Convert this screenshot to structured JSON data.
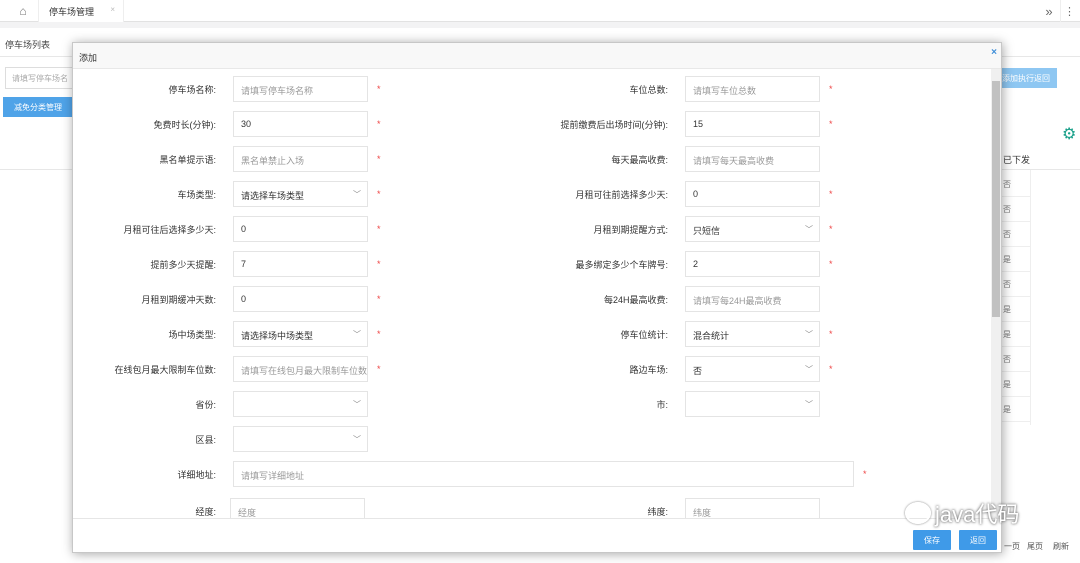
{
  "topbar": {
    "home_icon": "home-icon",
    "tab_label": "停车场管理",
    "tab_close": "×",
    "more_icon": "»"
  },
  "background": {
    "title": "停车场列表",
    "search_placeholder": "请填写停车场名",
    "blue_button": "减免分类管理",
    "right_button": "添加执行返回",
    "column_header": "已下发",
    "cells": [
      "否",
      "否",
      "否",
      "是",
      "否",
      "是",
      "是",
      "否",
      "是",
      "是"
    ],
    "pager": {
      "last": "尾页",
      "refresh": "刷新",
      "prev": "一页"
    }
  },
  "modal": {
    "title": "添加",
    "close": "×",
    "save_label": "保存",
    "back_label": "返回",
    "fields": {
      "parking_name": {
        "label": "停车场名称:",
        "placeholder": "请填写停车场名称"
      },
      "total_spaces": {
        "label": "车位总数:",
        "placeholder": "请填写车位总数"
      },
      "free_minutes": {
        "label": "免费时长(分钟):",
        "value": "30"
      },
      "exit_after_pay": {
        "label": "提前缴费后出场时间(分钟):",
        "value": "15"
      },
      "blacklist_tip": {
        "label": "黑名单提示语:",
        "value": "黑名单禁止入场"
      },
      "daily_max_fee": {
        "label": "每天最高收费:",
        "placeholder": "请填写每天最高收费"
      },
      "lot_type": {
        "label": "车场类型:",
        "value": "请选择车场类型"
      },
      "monthly_before_days": {
        "label": "月租可往前选择多少天:",
        "value": "0"
      },
      "monthly_after_days": {
        "label": "月租可往后选择多少天:",
        "value": "0"
      },
      "expire_reminder": {
        "label": "月租到期提醒方式:",
        "value": "只短信"
      },
      "remind_days": {
        "label": "提前多少天提醒:",
        "value": "7"
      },
      "max_plates": {
        "label": "最多绑定多少个车牌号:",
        "value": "2"
      },
      "grace_days": {
        "label": "月租到期缓冲天数:",
        "value": "0"
      },
      "max_24h_fee": {
        "label": "每24H最高收费:",
        "placeholder": "请填写每24H最高收费"
      },
      "inner_lot_type": {
        "label": "场中场类型:",
        "value": "请选择场中场类型"
      },
      "space_stats": {
        "label": "停车位统计:",
        "value": "混合统计"
      },
      "online_monthly_limit": {
        "label": "在线包月最大限制车位数:",
        "placeholder": "请填写在线包月最大限制车位数"
      },
      "roadside": {
        "label": "路边车场:",
        "value": "否"
      },
      "province": {
        "label": "省份:",
        "value": ""
      },
      "city": {
        "label": "市:",
        "value": ""
      },
      "district": {
        "label": "区县:",
        "value": ""
      },
      "address": {
        "label": "详细地址:",
        "placeholder": "请填写详细地址"
      },
      "longitude": {
        "label": "经度:",
        "placeholder": "经度"
      },
      "latitude": {
        "label": "纬度:",
        "placeholder": "纬度"
      }
    },
    "required_mark": "*",
    "dropdown_icon": "chevron-down-icon"
  },
  "watermark": "java代码"
}
